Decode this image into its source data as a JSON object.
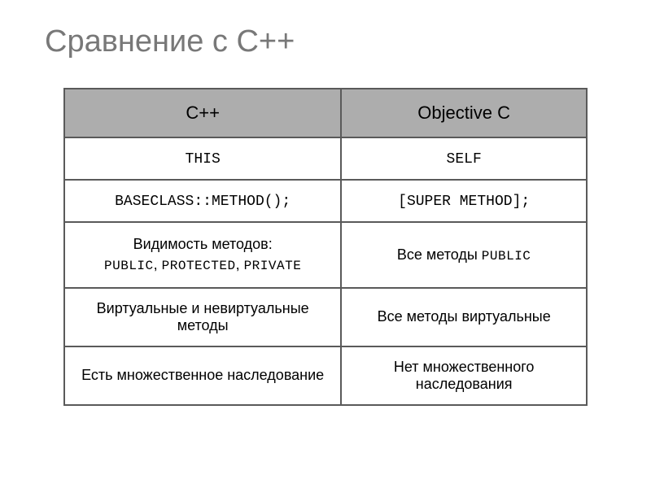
{
  "title": "Сравнение с C++",
  "table": {
    "headers": {
      "col1": "C++",
      "col2": "Objective C"
    },
    "rows": [
      {
        "col1": {
          "text": "THIS",
          "style": "mono"
        },
        "col2": {
          "text": "SELF",
          "style": "mono"
        }
      },
      {
        "col1": {
          "text": "BASECLASS::METHOD();",
          "style": "mono"
        },
        "col2": {
          "text": "[SUPER METHOD];",
          "style": "mono"
        }
      },
      {
        "col1": {
          "line1": "Видимость методов:",
          "line2_parts": [
            "PUBLIC",
            ", ",
            "PROTECTED",
            ", ",
            "PRIVATE"
          ]
        },
        "col2": {
          "prefix": "Все методы ",
          "kw": "PUBLIC"
        }
      },
      {
        "col1": {
          "text": "Виртуальные и невиртуальные методы",
          "style": "row-text"
        },
        "col2": {
          "text": "Все методы виртуальные",
          "style": "row-text"
        }
      },
      {
        "col1": {
          "text": "Есть множественное наследование",
          "style": "row-text"
        },
        "col2": {
          "text": "Нет множественного наследования",
          "style": "row-text"
        }
      }
    ]
  }
}
